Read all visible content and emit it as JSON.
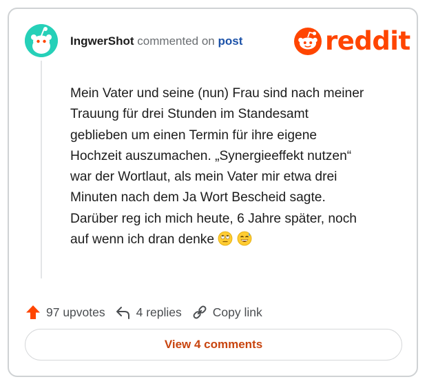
{
  "header": {
    "username": "IngwerShot",
    "meta": "commented on",
    "post_link": "post"
  },
  "logo": {
    "word": "reddit",
    "icon": "reddit-snoo-icon",
    "color": "#ff4500"
  },
  "avatar": {
    "icon": "snoo-avatar-icon",
    "color": "#26d0b8"
  },
  "comment": {
    "lines": [
      "Mein Vater und seine (nun) Frau sind nach meiner",
      "Trauung für drei Stunden im Standesamt",
      "geblieben um einen Termin für ihre eigene",
      "Hochzeit auszumachen. „Synergieeffekt nutzen“",
      "war der Wortlaut, als mein Vater mir etwa drei",
      "Minuten nach dem Ja Wort Bescheid sagte.",
      "Darüber reg ich mich heute, 6 Jahre später, noch",
      "auf wenn ich dran denke"
    ],
    "emojis": [
      "eye-roll-emoji",
      "sweat-smile-emoji"
    ]
  },
  "actions": {
    "upvotes": "97 upvotes",
    "replies": "4 replies",
    "copy_link": "Copy link"
  },
  "footer": {
    "view_comments": "View 4 comments"
  },
  "colors": {
    "accent": "#ff4500",
    "link": "#1c52a8",
    "button_text": "#c8440e"
  }
}
